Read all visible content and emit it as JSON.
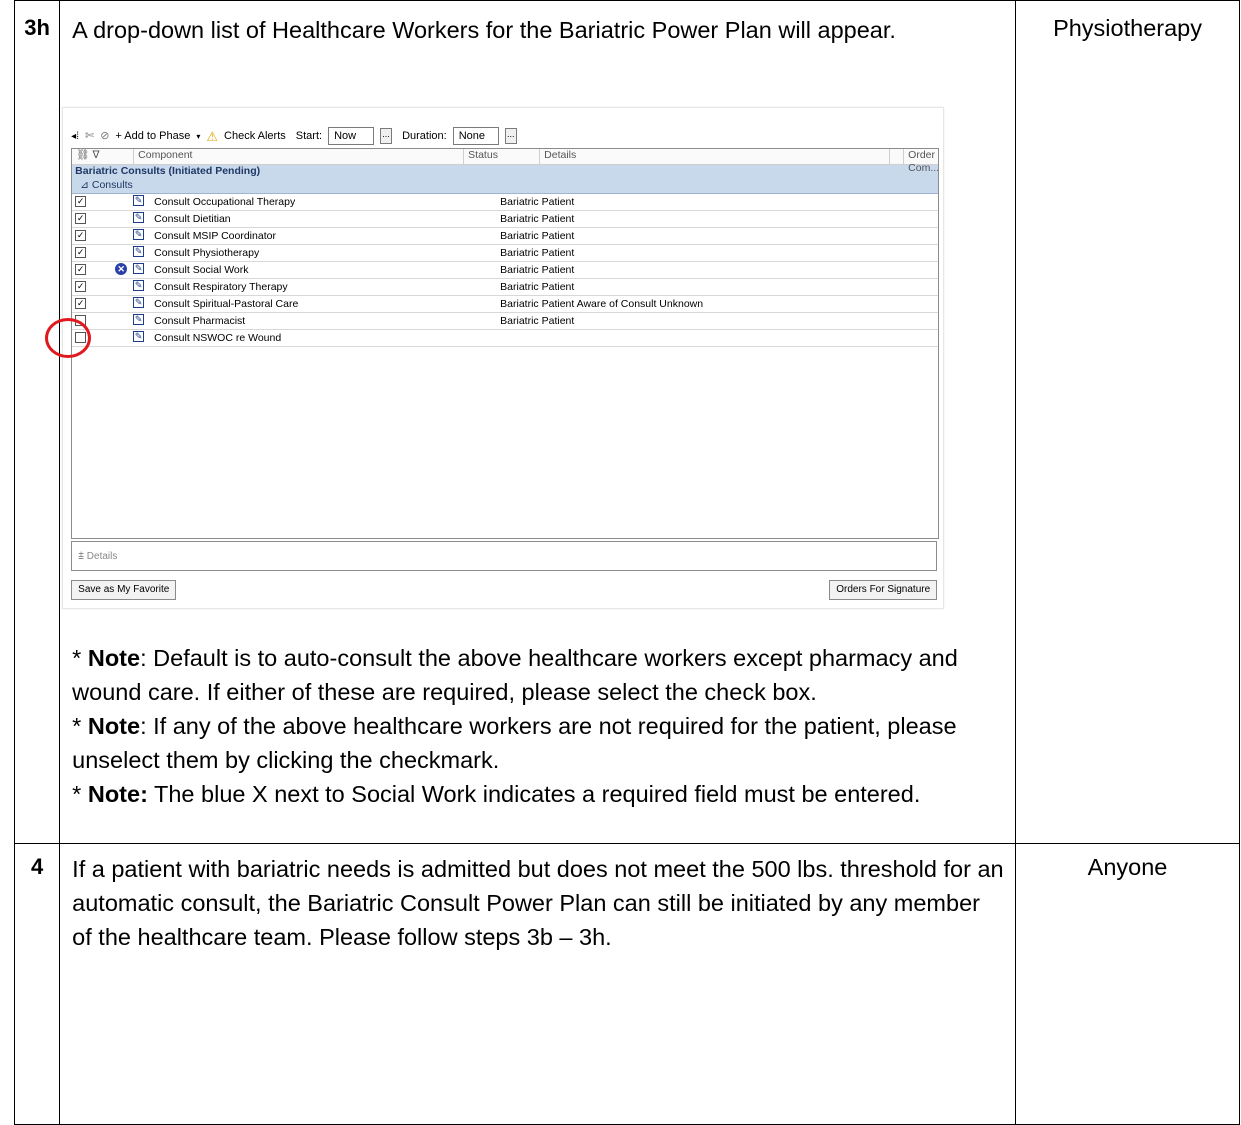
{
  "rows": [
    {
      "step": "3h",
      "description": "A drop-down list of Healthcare Workers for the Bariatric Power Plan will appear.",
      "role": "Physiotherapy",
      "notes": [
        {
          "prefix": "* ",
          "bold": "Note",
          "text": ": Default is to auto-consult the above healthcare workers except pharmacy and wound care. If either of these are required, please select the check box."
        },
        {
          "prefix": "* ",
          "bold": "Note",
          "text": ": If any of the above healthcare workers are not required for the patient, please unselect them by clicking the checkmark."
        },
        {
          "prefix": "* ",
          "bold": "Note:",
          "text": " The blue X next to Social Work indicates a required field must be entered."
        }
      ]
    },
    {
      "step": "4",
      "description": "If a patient with bariatric needs is admitted but does not meet the 500 lbs. threshold for an automatic consult, the Bariatric Consult Power Plan can still be initiated by any member of the healthcare team. Please follow steps 3b – 3h.",
      "role": "Anyone"
    }
  ],
  "screenshot": {
    "toolbar": {
      "add_to_phase": "+ Add to Phase",
      "check_alerts": "Check Alerts",
      "start_label": "Start:",
      "start_value": "Now",
      "duration_label": "Duration:",
      "duration_value": "None",
      "ellipsis": "..."
    },
    "columns": [
      "Component",
      "Status",
      "Details",
      "Order Com..."
    ],
    "group_title": "Bariatric Consults (Initiated Pending)",
    "subgroup": "⊿ Consults",
    "items": [
      {
        "component": "Consult Occupational Therapy",
        "details": "Bariatric Patient",
        "checked": true,
        "required": false
      },
      {
        "component": "Consult Dietitian",
        "details": "Bariatric Patient",
        "checked": true,
        "required": false
      },
      {
        "component": "Consult MSIP Coordinator",
        "details": "Bariatric Patient",
        "checked": true,
        "required": false
      },
      {
        "component": "Consult Physiotherapy",
        "details": "Bariatric Patient",
        "checked": true,
        "required": false
      },
      {
        "component": "Consult Social Work",
        "details": "Bariatric Patient",
        "checked": true,
        "required": true
      },
      {
        "component": "Consult Respiratory Therapy",
        "details": "Bariatric Patient",
        "checked": true,
        "required": false
      },
      {
        "component": "Consult Spiritual-Pastoral Care",
        "details": "Bariatric Patient Aware of Consult Unknown",
        "checked": true,
        "required": false
      },
      {
        "component": "Consult Pharmacist",
        "details": "Bariatric Patient",
        "checked": false,
        "required": false
      },
      {
        "component": "Consult NSWOC re Wound",
        "details": "",
        "checked": false,
        "required": false
      }
    ],
    "details_label": "Details",
    "save_favorite": "Save as My Favorite",
    "orders_signature": "Orders For Signature",
    "colors": {
      "band": "#c9d9ec",
      "highlight": "#e0191f",
      "required_icon": "#2a3fa8"
    }
  }
}
